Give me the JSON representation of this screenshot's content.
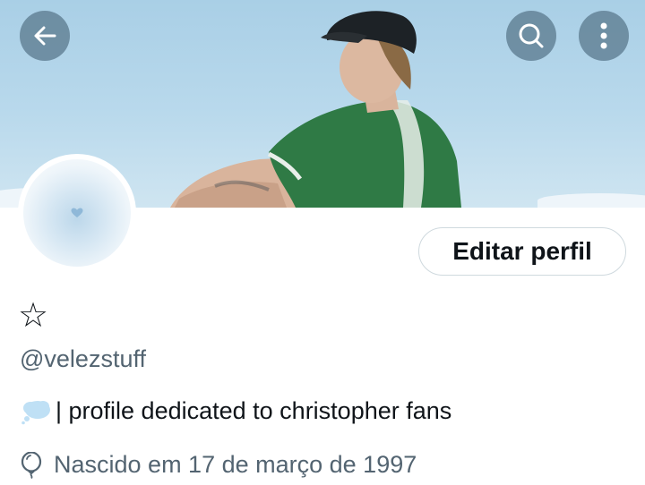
{
  "header": {
    "back_icon": "arrow-left-icon",
    "search_icon": "search-icon",
    "more_icon": "more-vertical-icon"
  },
  "banner": {
    "description_hidden": true,
    "sky_color": "#b9d9ec",
    "jacket_color": "#2f7a45"
  },
  "profile": {
    "display_name": "☆",
    "handle": "@velezstuff",
    "bio_emoji_icon": "thought-bubble-icon",
    "bio_text": "| profile dedicated to christopher fans",
    "birth_icon": "balloon-icon",
    "birth_text": "Nascido em 17 de março de 1997"
  },
  "actions": {
    "edit_profile_label": "Editar perfil"
  },
  "colors": {
    "text_primary": "#0f1419",
    "text_secondary": "#536471",
    "button_border": "#cfd9de",
    "avatar_heart": "#8fb8d8"
  }
}
